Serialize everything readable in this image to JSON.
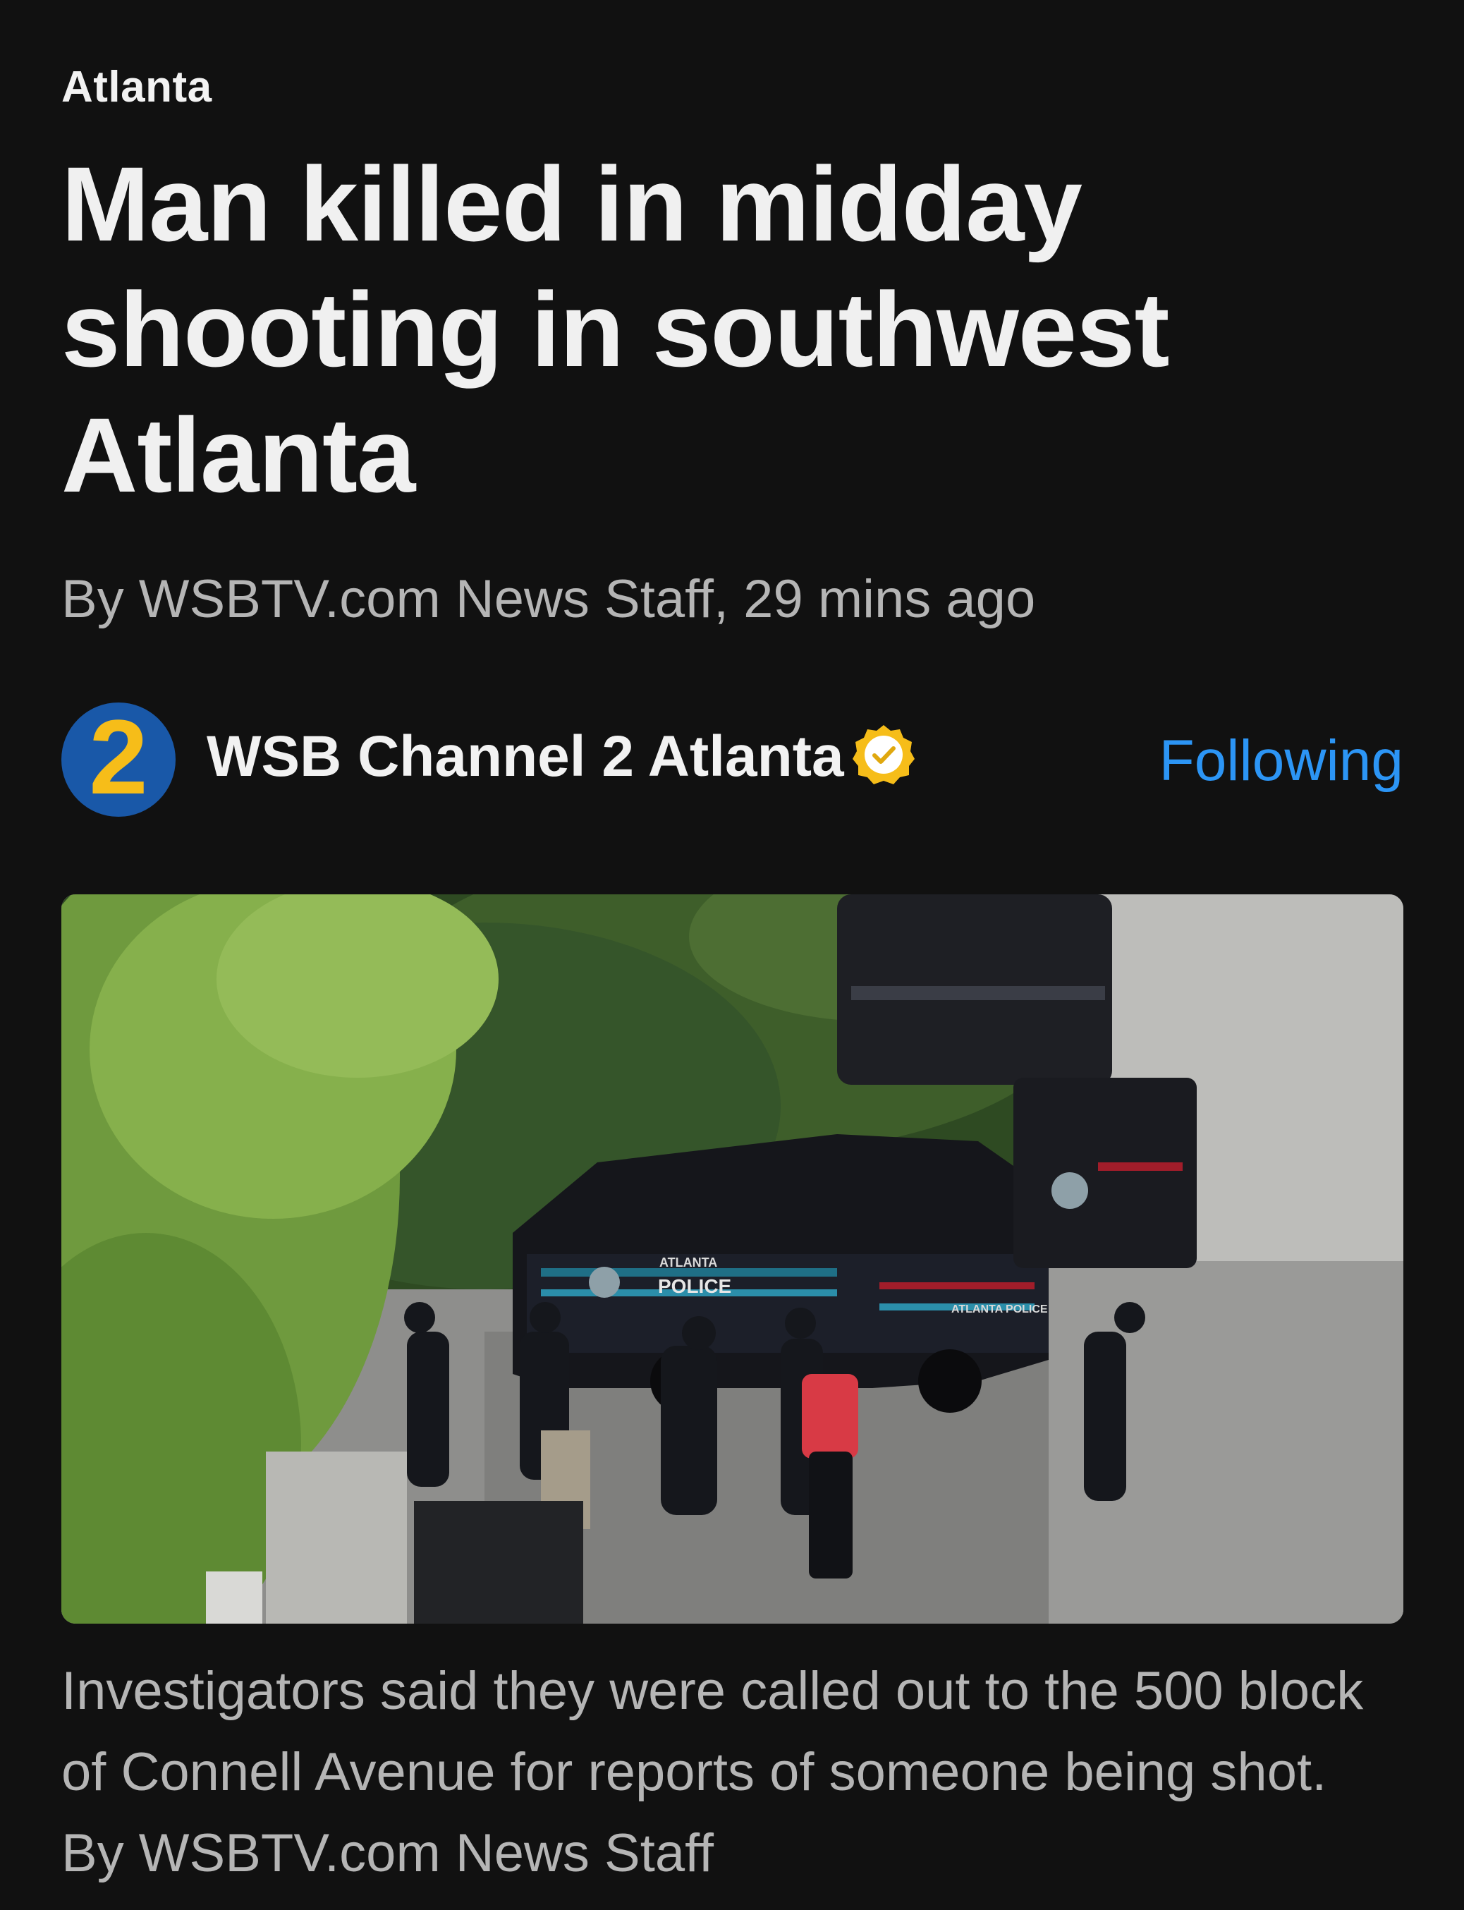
{
  "article": {
    "category": "Atlanta",
    "headline": "Man killed in midday shooting in southwest Atlanta",
    "byline": "By WSBTV.com News Staff,  29 mins ago",
    "caption": "Investigators said they were called out to the 500 block of Connell Avenue for reports of someone being shot. By WSBTV.com News Staff"
  },
  "source": {
    "logo_text": "2",
    "name": "WSB Channel 2 Atlanta",
    "verified_icon": "verified-badge-icon",
    "follow_label": "Following"
  },
  "photo": {
    "vehicle_text_1": "ATLANTA",
    "vehicle_text_2": "POLICE",
    "vehicle_text_3": "ATLANTA POLICE"
  },
  "colors": {
    "background": "#111111",
    "accent": "#2c95f5",
    "badge": "#f6bd19",
    "logo_blue": "#1958a8"
  }
}
